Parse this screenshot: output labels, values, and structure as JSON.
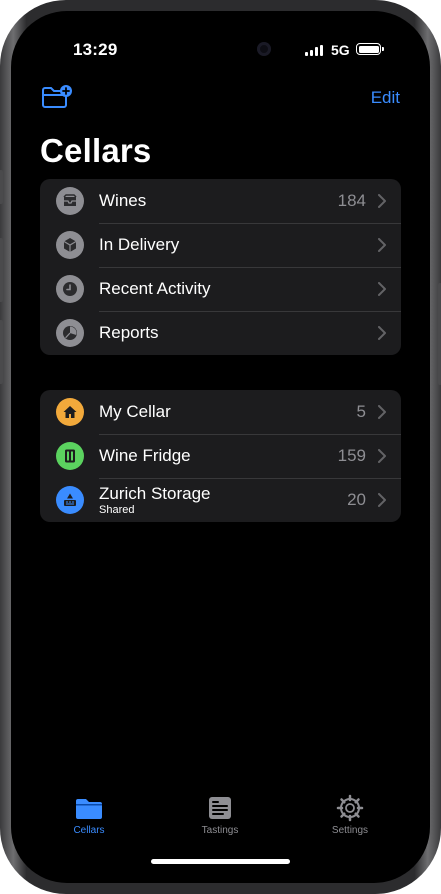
{
  "status_bar": {
    "time": "13:29",
    "network": "5G"
  },
  "nav": {
    "add_icon": "folder-plus-icon",
    "edit_label": "Edit",
    "title": "Cellars"
  },
  "colors": {
    "accent": "#3a8cff",
    "group_bg": "#1c1c1e",
    "secondary_text": "#8e8e93",
    "tab_inactive": "#8e8e93"
  },
  "overview": [
    {
      "label": "Wines",
      "count": "184",
      "icon": "wine-box-icon",
      "icon_color": "#8e8e93"
    },
    {
      "label": "In Delivery",
      "count": "",
      "icon": "package-icon",
      "icon_color": "#8e8e93"
    },
    {
      "label": "Recent Activity",
      "count": "",
      "icon": "clock-icon",
      "icon_color": "#8e8e93"
    },
    {
      "label": "Reports",
      "count": "",
      "icon": "pie-chart-icon",
      "icon_color": "#8e8e93"
    }
  ],
  "cellars": [
    {
      "label": "My Cellar",
      "subtitle": "",
      "count": "5",
      "icon": "house-icon",
      "icon_color": "#f2a93b"
    },
    {
      "label": "Wine Fridge",
      "subtitle": "",
      "count": "159",
      "icon": "fridge-icon",
      "icon_color": "#5bd25f"
    },
    {
      "label": "Zurich Storage",
      "subtitle": "Shared",
      "count": "20",
      "icon": "storage-icon",
      "icon_color": "#3a8cff"
    }
  ],
  "tab_bar": {
    "tabs": [
      {
        "label": "Cellars",
        "icon": "folder-icon",
        "active": true
      },
      {
        "label": "Tastings",
        "icon": "tasting-note-icon",
        "active": false
      },
      {
        "label": "Settings",
        "icon": "gear-icon",
        "active": false
      }
    ]
  }
}
